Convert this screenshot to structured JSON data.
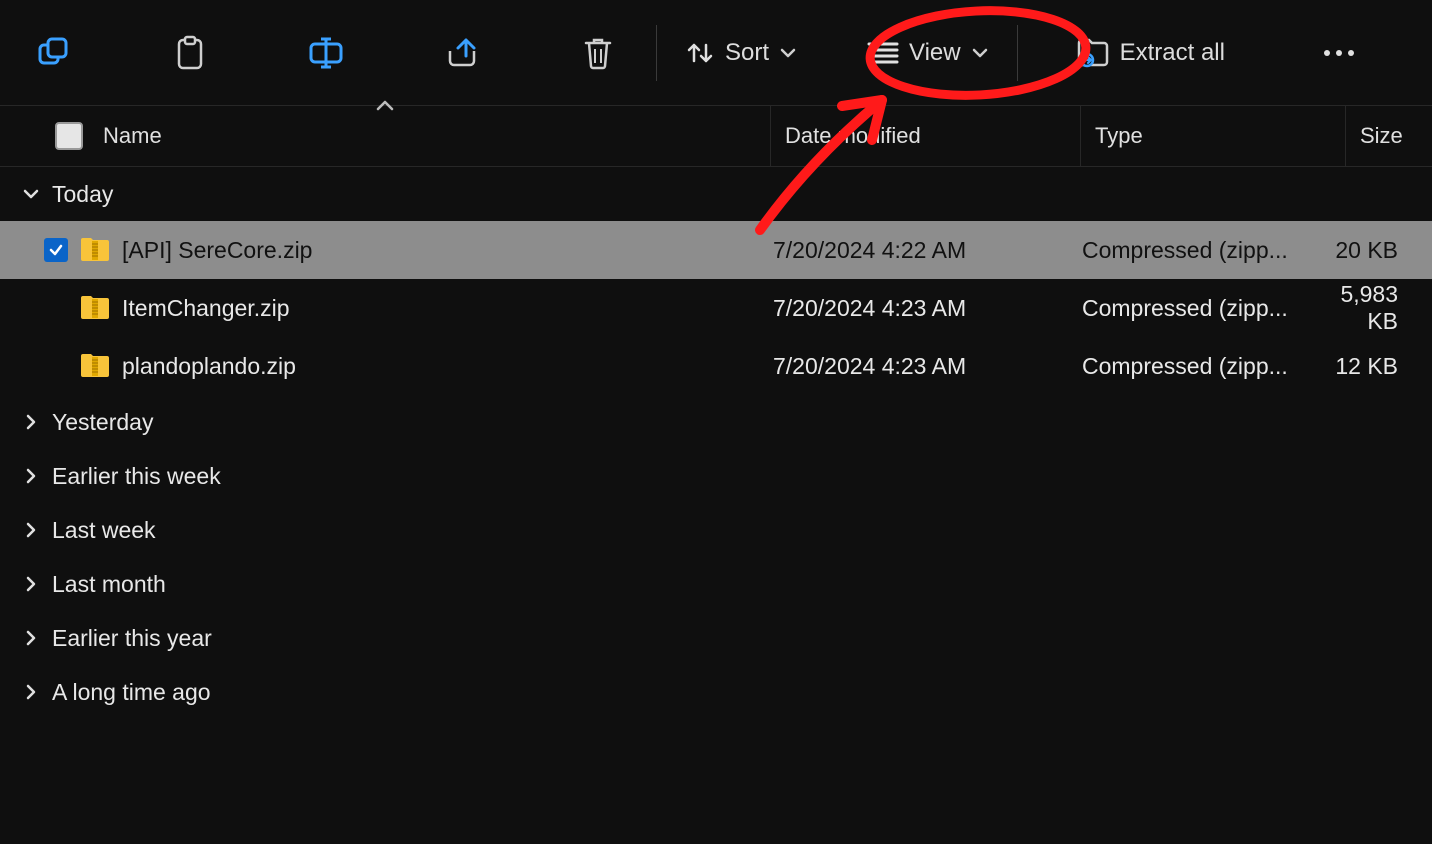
{
  "toolbar": {
    "sort_label": "Sort",
    "view_label": "View",
    "extract_label": "Extract all"
  },
  "columns": {
    "name": "Name",
    "date": "Date modified",
    "type": "Type",
    "size": "Size"
  },
  "groups": {
    "today": "Today",
    "yesterday": "Yesterday",
    "earlier_week": "Earlier this week",
    "last_week": "Last week",
    "last_month": "Last month",
    "earlier_year": "Earlier this year",
    "long_ago": "A long time ago"
  },
  "files": [
    {
      "name": "[API] SereCore.zip",
      "date": "7/20/2024 4:22 AM",
      "type": "Compressed (zipp...",
      "size": "20 KB",
      "selected": true
    },
    {
      "name": "ItemChanger.zip",
      "date": "7/20/2024 4:23 AM",
      "type": "Compressed (zipp...",
      "size": "5,983 KB",
      "selected": false
    },
    {
      "name": "plandoplando.zip",
      "date": "7/20/2024 4:23 AM",
      "type": "Compressed (zipp...",
      "size": "12 KB",
      "selected": false
    }
  ]
}
